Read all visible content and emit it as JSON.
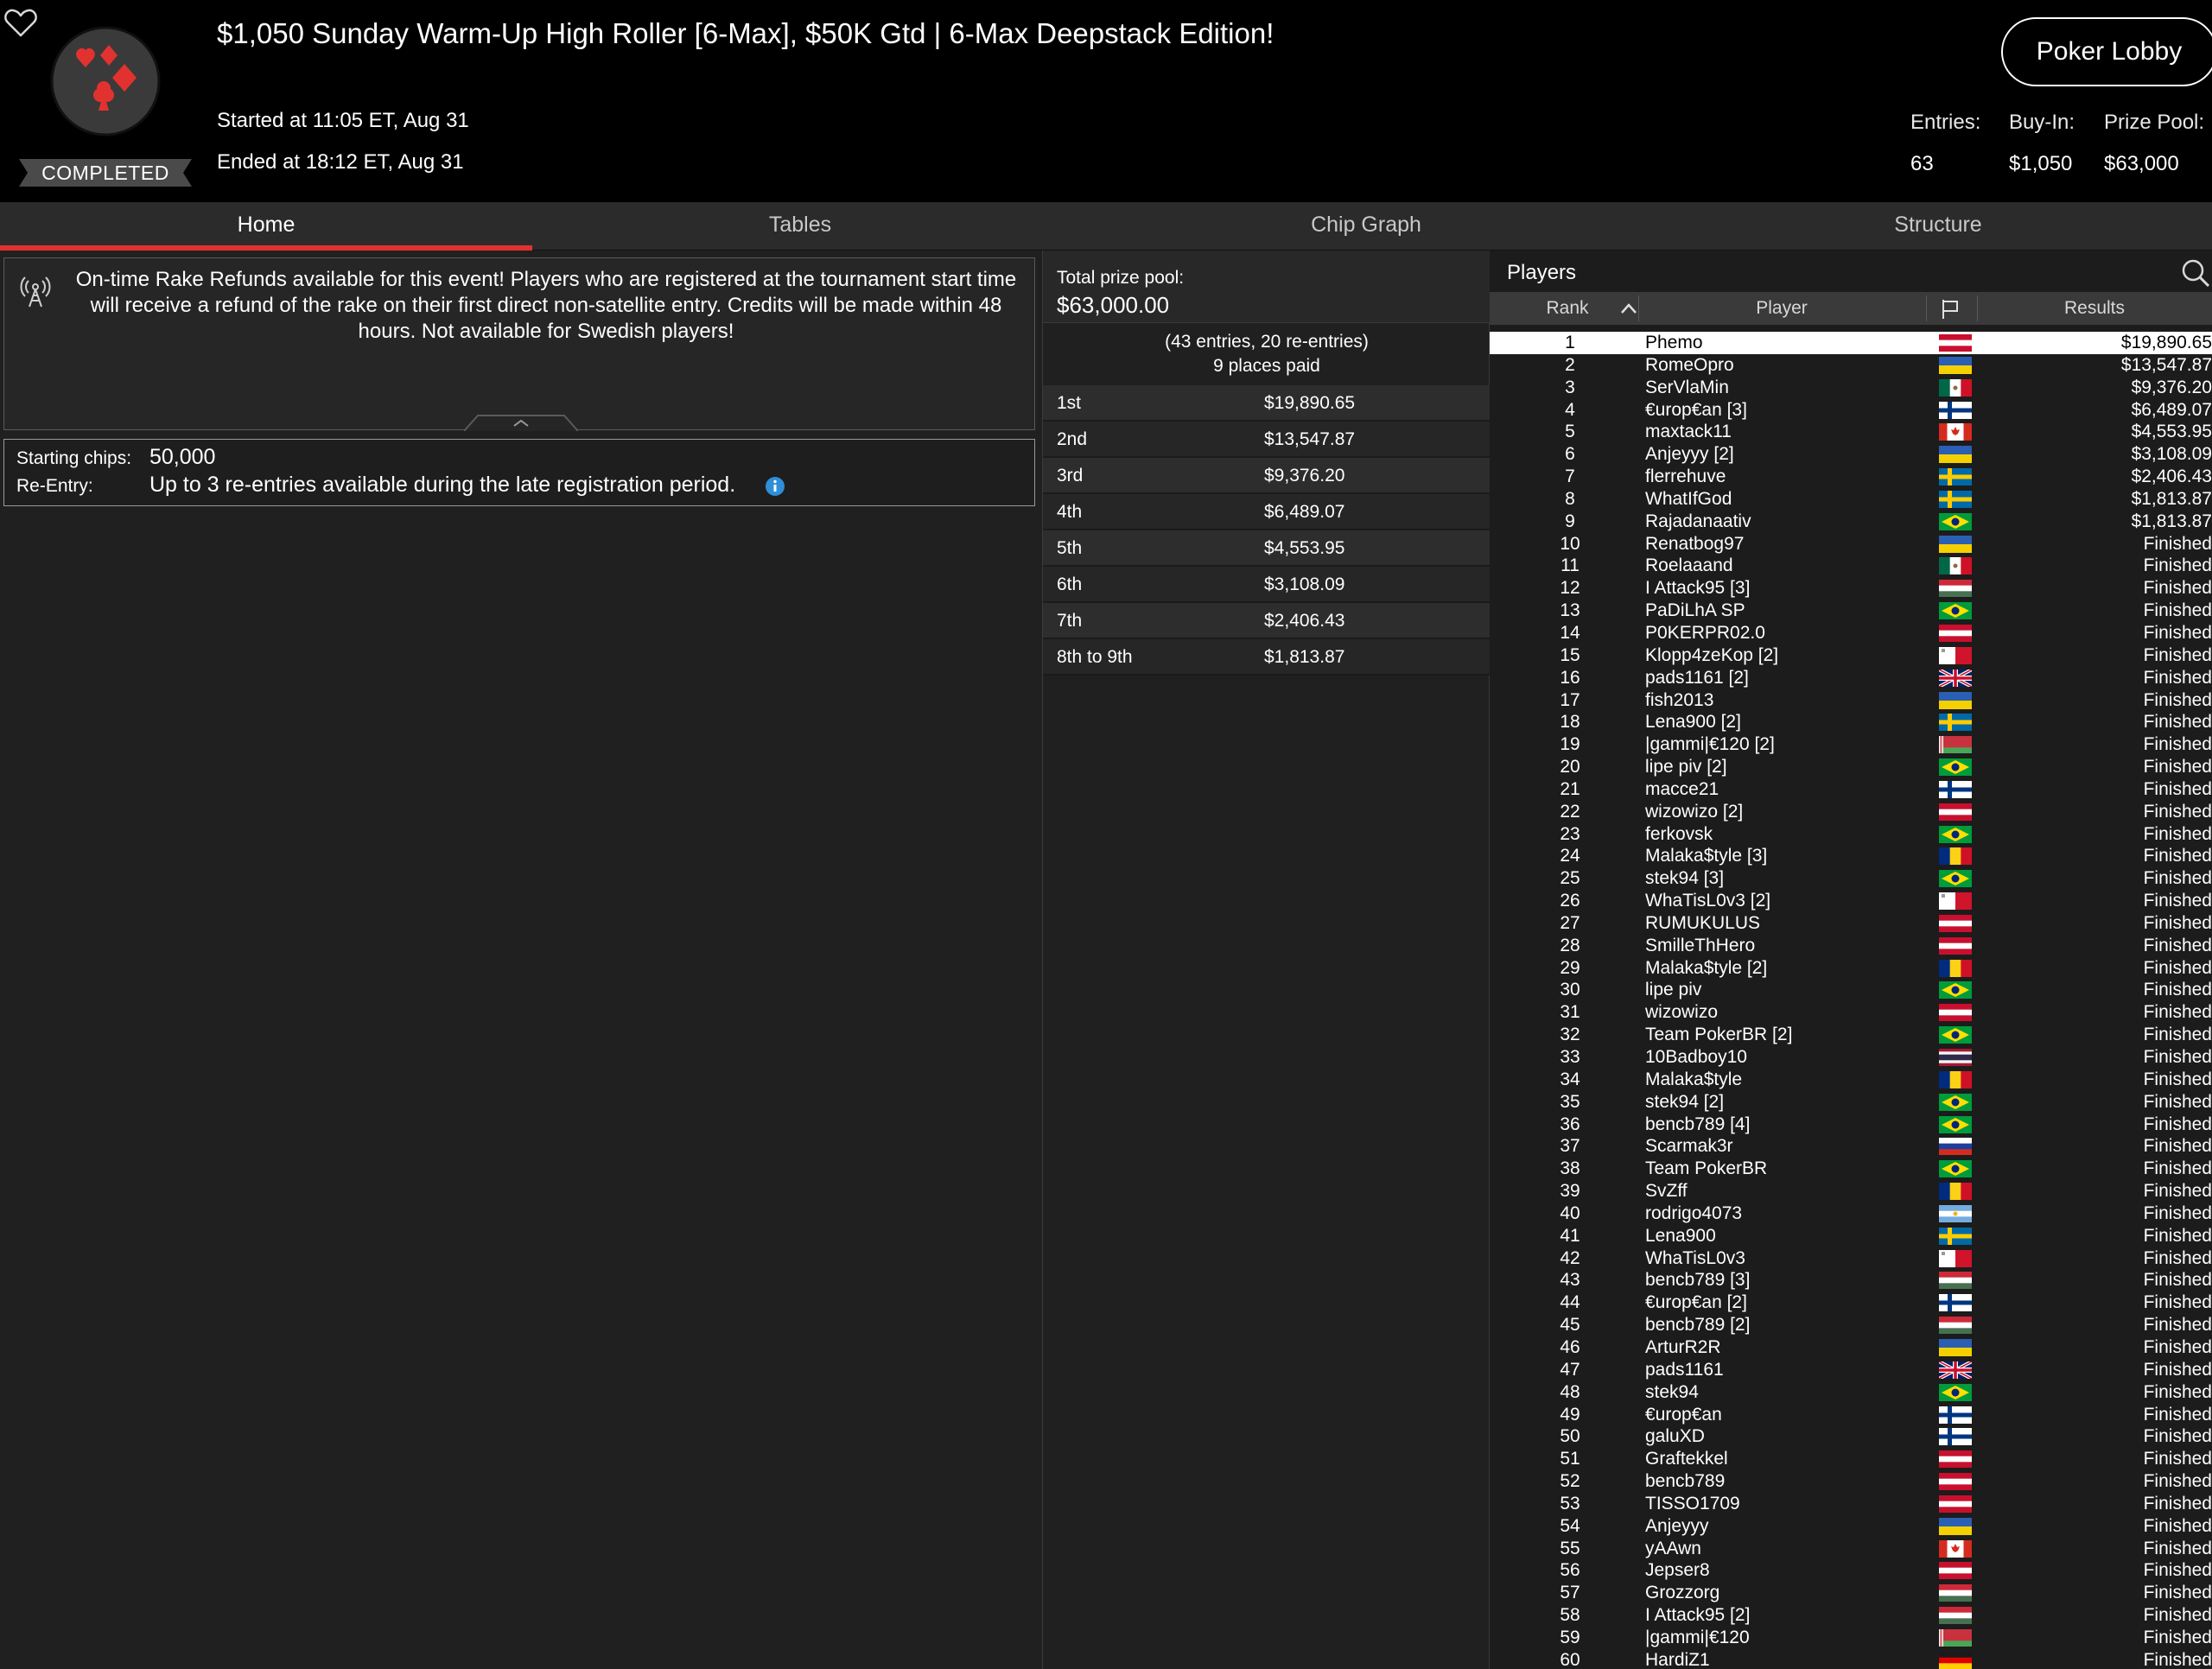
{
  "header": {
    "title": "$1,050 Sunday Warm-Up High Roller [6-Max], $50K Gtd | 6-Max Deepstack Edition!",
    "status": "COMPLETED",
    "started": "Started at 11:05 ET, Aug 31",
    "ended": "Ended at 18:12 ET, Aug 31",
    "lobby_button": "Poker Lobby",
    "stats": [
      {
        "label": "Entries:",
        "value": "63"
      },
      {
        "label": "Buy-In:",
        "value": "$1,050"
      },
      {
        "label": "Prize Pool:",
        "value": "$63,000"
      }
    ],
    "colors": {
      "accent": "#e2322f",
      "logo_bg": "#3a3a3a"
    }
  },
  "tabs": [
    "Home",
    "Tables",
    "Chip Graph",
    "Structure"
  ],
  "active_tab": "Home",
  "notice": {
    "icon": "broadcast-antenna-icon",
    "text": "On-time Rake Refunds available for this event! Players who are registered at the tournament start time will receive a refund of the rake on their first direct non-satellite entry. Credits will be made within 48 hours. Not available for Swedish players!"
  },
  "details": {
    "starting_chips_label": "Starting chips:",
    "starting_chips_value": "50,000",
    "reentry_label": "Re-Entry:",
    "reentry_value": "Up to 3 re-entries available during the late registration period."
  },
  "prize_pool": {
    "label": "Total prize pool:",
    "value": "$63,000.00",
    "entries_line": "(43 entries, 20 re-entries)",
    "places_line": "9 places paid",
    "places": [
      {
        "pos": "1st",
        "amount": "$19,890.65"
      },
      {
        "pos": "2nd",
        "amount": "$13,547.87"
      },
      {
        "pos": "3rd",
        "amount": "$9,376.20"
      },
      {
        "pos": "4th",
        "amount": "$6,489.07"
      },
      {
        "pos": "5th",
        "amount": "$4,553.95"
      },
      {
        "pos": "6th",
        "amount": "$3,108.09"
      },
      {
        "pos": "7th",
        "amount": "$2,406.43"
      },
      {
        "pos": "8th to 9th",
        "amount": "$1,813.87"
      }
    ]
  },
  "players": {
    "title": "Players",
    "columns": {
      "rank": "Rank",
      "player": "Player",
      "results": "Results"
    },
    "rows": [
      {
        "rank": "1",
        "name": "Phemo",
        "flag": "austria",
        "result": "$19,890.65"
      },
      {
        "rank": "2",
        "name": "RomeOpro",
        "flag": "ukraine",
        "result": "$13,547.87"
      },
      {
        "rank": "3",
        "name": "SerVlaMin",
        "flag": "mexico",
        "result": "$9,376.20"
      },
      {
        "rank": "4",
        "name": "€urop€an [3]",
        "flag": "finland",
        "result": "$6,489.07"
      },
      {
        "rank": "5",
        "name": "maxtack11",
        "flag": "canada",
        "result": "$4,553.95"
      },
      {
        "rank": "6",
        "name": "Anjeyyy [2]",
        "flag": "ukraine",
        "result": "$3,108.09"
      },
      {
        "rank": "7",
        "name": "flerrehuve",
        "flag": "sweden",
        "result": "$2,406.43"
      },
      {
        "rank": "8",
        "name": "WhatIfGod",
        "flag": "sweden",
        "result": "$1,813.87"
      },
      {
        "rank": "9",
        "name": "Rajadanaativ",
        "flag": "brazil",
        "result": "$1,813.87"
      },
      {
        "rank": "10",
        "name": "Renatbog97",
        "flag": "ukraine",
        "result": "Finished"
      },
      {
        "rank": "11",
        "name": "Roelaaand",
        "flag": "mexico",
        "result": "Finished"
      },
      {
        "rank": "12",
        "name": "I Attack95 [3]",
        "flag": "hungary",
        "result": "Finished"
      },
      {
        "rank": "13",
        "name": "PaDiLhA SP",
        "flag": "brazil",
        "result": "Finished"
      },
      {
        "rank": "14",
        "name": "P0KERPR02.0",
        "flag": "austria",
        "result": "Finished"
      },
      {
        "rank": "15",
        "name": "Klopp4zeKop [2]",
        "flag": "malta",
        "result": "Finished"
      },
      {
        "rank": "16",
        "name": "pads1161 [2]",
        "flag": "uk",
        "result": "Finished"
      },
      {
        "rank": "17",
        "name": "fish2013",
        "flag": "ukraine",
        "result": "Finished"
      },
      {
        "rank": "18",
        "name": "Lena900 [2]",
        "flag": "sweden",
        "result": "Finished"
      },
      {
        "rank": "19",
        "name": "|gammi|€120 [2]",
        "flag": "belarus",
        "result": "Finished"
      },
      {
        "rank": "20",
        "name": "lipe piv [2]",
        "flag": "brazil",
        "result": "Finished"
      },
      {
        "rank": "21",
        "name": "macce21",
        "flag": "finland",
        "result": "Finished"
      },
      {
        "rank": "22",
        "name": "wizowizo [2]",
        "flag": "austria",
        "result": "Finished"
      },
      {
        "rank": "23",
        "name": "ferkovsk",
        "flag": "brazil",
        "result": "Finished"
      },
      {
        "rank": "24",
        "name": "Malaka$tyle [3]",
        "flag": "romania",
        "result": "Finished"
      },
      {
        "rank": "25",
        "name": "stek94 [3]",
        "flag": "brazil",
        "result": "Finished"
      },
      {
        "rank": "26",
        "name": "WhaTisL0v3 [2]",
        "flag": "malta",
        "result": "Finished"
      },
      {
        "rank": "27",
        "name": "RUMUKULUS",
        "flag": "austria",
        "result": "Finished"
      },
      {
        "rank": "28",
        "name": "SmilleThHero",
        "flag": "austria",
        "result": "Finished"
      },
      {
        "rank": "29",
        "name": "Malaka$tyle [2]",
        "flag": "romania",
        "result": "Finished"
      },
      {
        "rank": "30",
        "name": "lipe piv",
        "flag": "brazil",
        "result": "Finished"
      },
      {
        "rank": "31",
        "name": "wizowizo",
        "flag": "austria",
        "result": "Finished"
      },
      {
        "rank": "32",
        "name": "Team PokerBR [2]",
        "flag": "brazil",
        "result": "Finished"
      },
      {
        "rank": "33",
        "name": "10Badboy10",
        "flag": "thailand",
        "result": "Finished"
      },
      {
        "rank": "34",
        "name": "Malaka$tyle",
        "flag": "romania",
        "result": "Finished"
      },
      {
        "rank": "35",
        "name": "stek94 [2]",
        "flag": "brazil",
        "result": "Finished"
      },
      {
        "rank": "36",
        "name": "bencb789 [4]",
        "flag": "brazil",
        "result": "Finished"
      },
      {
        "rank": "37",
        "name": "Scarmak3r",
        "flag": "slovenia",
        "result": "Finished"
      },
      {
        "rank": "38",
        "name": "Team PokerBR",
        "flag": "brazil",
        "result": "Finished"
      },
      {
        "rank": "39",
        "name": "SvZff",
        "flag": "romania",
        "result": "Finished"
      },
      {
        "rank": "40",
        "name": "rodrigo4073",
        "flag": "argentina",
        "result": "Finished"
      },
      {
        "rank": "41",
        "name": "Lena900",
        "flag": "sweden",
        "result": "Finished"
      },
      {
        "rank": "42",
        "name": "WhaTisL0v3",
        "flag": "malta",
        "result": "Finished"
      },
      {
        "rank": "43",
        "name": "bencb789 [3]",
        "flag": "hungary",
        "result": "Finished"
      },
      {
        "rank": "44",
        "name": "€urop€an [2]",
        "flag": "finland",
        "result": "Finished"
      },
      {
        "rank": "45",
        "name": "bencb789 [2]",
        "flag": "hungary",
        "result": "Finished"
      },
      {
        "rank": "46",
        "name": "ArturR2R",
        "flag": "ukraine",
        "result": "Finished"
      },
      {
        "rank": "47",
        "name": "pads1161",
        "flag": "uk",
        "result": "Finished"
      },
      {
        "rank": "48",
        "name": "stek94",
        "flag": "brazil",
        "result": "Finished"
      },
      {
        "rank": "49",
        "name": "€urop€an",
        "flag": "finland",
        "result": "Finished"
      },
      {
        "rank": "50",
        "name": "galuXD",
        "flag": "finland",
        "result": "Finished"
      },
      {
        "rank": "51",
        "name": "Graftekkel",
        "flag": "austria",
        "result": "Finished"
      },
      {
        "rank": "52",
        "name": "bencb789",
        "flag": "austria",
        "result": "Finished"
      },
      {
        "rank": "53",
        "name": "TISSO1709",
        "flag": "austria",
        "result": "Finished"
      },
      {
        "rank": "54",
        "name": "Anjeyyy",
        "flag": "ukraine",
        "result": "Finished"
      },
      {
        "rank": "55",
        "name": "yAAwn",
        "flag": "canada",
        "result": "Finished"
      },
      {
        "rank": "56",
        "name": "Jepser8",
        "flag": "austria",
        "result": "Finished"
      },
      {
        "rank": "57",
        "name": "Grozzorg",
        "flag": "hungary",
        "result": "Finished"
      },
      {
        "rank": "58",
        "name": "I Attack95 [2]",
        "flag": "hungary",
        "result": "Finished"
      },
      {
        "rank": "59",
        "name": "|gammi|€120",
        "flag": "belarus",
        "result": "Finished"
      },
      {
        "rank": "60",
        "name": "HardiZ1",
        "flag": "germany",
        "result": "Finished"
      }
    ]
  }
}
